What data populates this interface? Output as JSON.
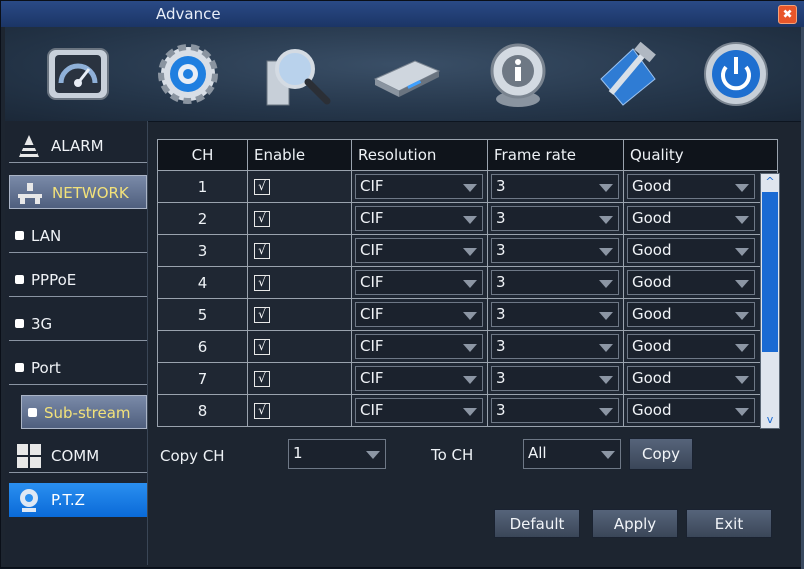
{
  "window": {
    "title": "Advance",
    "close_symbol": "✖"
  },
  "toolbar": [
    {
      "icon": "dashboard-icon"
    },
    {
      "icon": "gear-icon"
    },
    {
      "icon": "search-magnifier-icon"
    },
    {
      "icon": "hard-disk-icon"
    },
    {
      "icon": "info-icon"
    },
    {
      "icon": "tools-icon"
    },
    {
      "icon": "power-icon"
    }
  ],
  "sidebar": {
    "items": [
      {
        "label": "ALARM",
        "icon": "alarm-cone-icon",
        "type": "main"
      },
      {
        "label": "NETWORK",
        "icon": "network-icon",
        "type": "main",
        "active": true
      },
      {
        "label": "LAN",
        "type": "sub"
      },
      {
        "label": "PPPoE",
        "type": "sub"
      },
      {
        "label": "3G",
        "type": "sub"
      },
      {
        "label": "Port",
        "type": "sub"
      },
      {
        "label": "Sub-stream",
        "type": "sub",
        "active": true
      },
      {
        "label": "COMM",
        "icon": "grid-icon",
        "type": "main"
      },
      {
        "label": "P.T.Z",
        "icon": "camera-icon",
        "type": "main"
      }
    ]
  },
  "table": {
    "headers": [
      "CH",
      "Enable",
      "Resolution",
      "Frame rate",
      "Quality"
    ],
    "check_symbol": "√",
    "rows": [
      {
        "ch": "1",
        "resolution": "CIF",
        "frame_rate": "3",
        "quality": "Good"
      },
      {
        "ch": "2",
        "resolution": "CIF",
        "frame_rate": "3",
        "quality": "Good"
      },
      {
        "ch": "3",
        "resolution": "CIF",
        "frame_rate": "3",
        "quality": "Good"
      },
      {
        "ch": "4",
        "resolution": "CIF",
        "frame_rate": "3",
        "quality": "Good"
      },
      {
        "ch": "5",
        "resolution": "CIF",
        "frame_rate": "3",
        "quality": "Good"
      },
      {
        "ch": "6",
        "resolution": "CIF",
        "frame_rate": "3",
        "quality": "Good"
      },
      {
        "ch": "7",
        "resolution": "CIF",
        "frame_rate": "3",
        "quality": "Good"
      },
      {
        "ch": "8",
        "resolution": "CIF",
        "frame_rate": "3",
        "quality": "Good"
      }
    ]
  },
  "scrollbar": {
    "up": "^",
    "down": "v"
  },
  "copy": {
    "copy_ch_label": "Copy CH",
    "copy_ch_value": "1",
    "to_ch_label": "To CH",
    "to_ch_value": "All",
    "copy_button": "Copy"
  },
  "footer": {
    "default_button": "Default",
    "apply_button": "Apply",
    "exit_button": "Exit"
  },
  "colors": {
    "accent": "#1a6ad3",
    "title_bar": "#1b3566",
    "active_text": "#f3e27a"
  }
}
